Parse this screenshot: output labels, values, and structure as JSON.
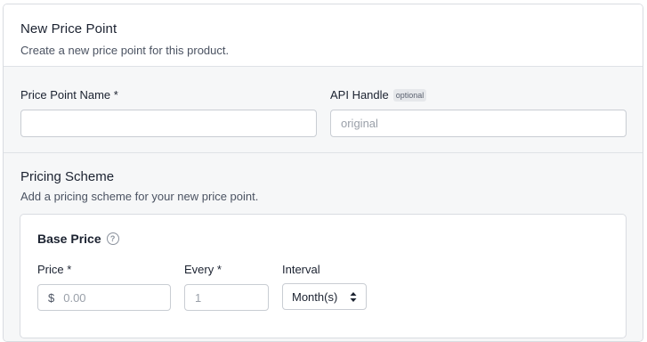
{
  "header": {
    "title": "New Price Point",
    "subtitle": "Create a new price point for this product."
  },
  "fields": {
    "name_label": "Price Point Name *",
    "name_value": "",
    "api_label": "API Handle",
    "api_badge": "optional",
    "api_placeholder": "original"
  },
  "pricing": {
    "title": "Pricing Scheme",
    "subtitle": "Add a pricing scheme for your new price point.",
    "base_price": {
      "title": "Base Price",
      "help_icon": "question-circle-icon",
      "price_label": "Price *",
      "currency": "$",
      "price_placeholder": "0.00",
      "every_label": "Every *",
      "every_placeholder": "1",
      "interval_label": "Interval",
      "interval_value": "Month(s)",
      "interval_icon": "sort-arrows-icon"
    }
  },
  "colors": {
    "border": "#d9dce1",
    "section_bg": "#f6f7f8",
    "text": "#1b2230",
    "muted": "#4b5362"
  }
}
